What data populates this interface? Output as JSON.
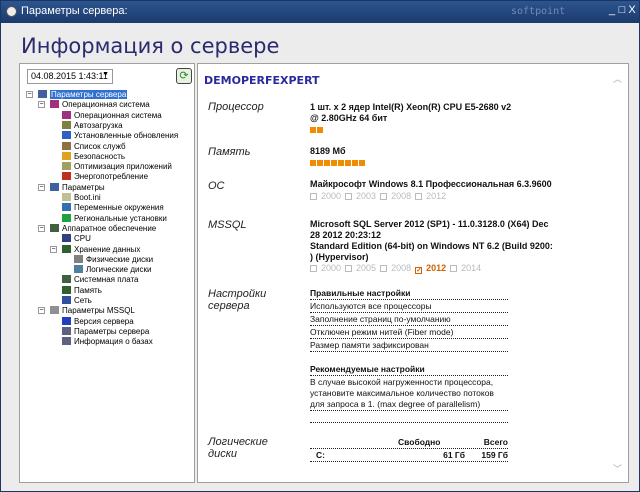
{
  "window": {
    "title": "Параметры сервера:",
    "brand": "softpoint",
    "minimize": "_",
    "maximize": "□",
    "close": "X"
  },
  "heading": "Информация о сервере",
  "date_combo": "04.08.2015 1:43:11",
  "tree": [
    {
      "label": "Параметры сервера",
      "level": 0,
      "color": "#4060a0",
      "expander": "−",
      "selected": true
    },
    {
      "label": "Операционная система",
      "level": 1,
      "color": "#a03080",
      "expander": "−"
    },
    {
      "label": "Операционная система",
      "level": 2,
      "color": "#a03080"
    },
    {
      "label": "Автозагрузка",
      "level": 2,
      "color": "#808040"
    },
    {
      "label": "Установленные обновления",
      "level": 2,
      "color": "#3060c0"
    },
    {
      "label": "Список служб",
      "level": 2,
      "color": "#907040"
    },
    {
      "label": "Безопасность",
      "level": 2,
      "color": "#e0a020"
    },
    {
      "label": "Оптимизация приложений",
      "level": 2,
      "color": "#a0a060"
    },
    {
      "label": "Энергопотребление",
      "level": 2,
      "color": "#c03020"
    },
    {
      "label": "Параметры",
      "level": 1,
      "color": "#4060a0",
      "expander": "−"
    },
    {
      "label": "Boot.ini",
      "level": 2,
      "color": "#c0c090"
    },
    {
      "label": "Переменные окружения",
      "level": 2,
      "color": "#3070b0"
    },
    {
      "label": "Региональные установки",
      "level": 2,
      "color": "#20a040"
    },
    {
      "label": "Аппаратное обеспечение",
      "level": 1,
      "color": "#406040",
      "expander": "−"
    },
    {
      "label": "CPU",
      "level": 2,
      "color": "#304080"
    },
    {
      "label": "Хранение данных",
      "level": 2,
      "color": "#306030",
      "expander": "−"
    },
    {
      "label": "Физические диски",
      "level": 3,
      "color": "#808080"
    },
    {
      "label": "Логические диски",
      "level": 3,
      "color": "#5080a0"
    },
    {
      "label": "Системная плата",
      "level": 2,
      "color": "#406040"
    },
    {
      "label": "Память",
      "level": 2,
      "color": "#306030"
    },
    {
      "label": "Сеть",
      "level": 2,
      "color": "#3050a0"
    },
    {
      "label": "Параметры MSSQL",
      "level": 1,
      "color": "#909090",
      "expander": "−"
    },
    {
      "label": "Версия сервера",
      "level": 2,
      "color": "#2040c0"
    },
    {
      "label": "Параметры сервера",
      "level": 2,
      "color": "#606080"
    },
    {
      "label": "Информация о базах",
      "level": 2,
      "color": "#606080"
    }
  ],
  "info": {
    "host": "DEMOPERFEXPERT",
    "cpu": {
      "label": "Процессор",
      "value": "1 шт. x 2 ядер Intel(R) Xeon(R) CPU E5-2680 v2 @ 2.80GHz 64 бит",
      "cores": 2
    },
    "memory": {
      "label": "Память",
      "value": "8189 Мб",
      "blocks": 8
    },
    "os": {
      "label": "ОС",
      "value": "Майкрософт Windows 8.1 Профессиональная 6.3.9600",
      "versions": [
        {
          "v": "2000",
          "checked": false
        },
        {
          "v": "2003",
          "checked": false
        },
        {
          "v": "2008",
          "checked": false
        },
        {
          "v": "2012",
          "checked": false
        }
      ]
    },
    "mssql": {
      "label": "MSSQL",
      "line1": "Microsoft SQL Server 2012 (SP1) - 11.0.3128.0 (X64) Dec 28 2012 20:23:12",
      "line2": "Standard Edition (64-bit) on Windows NT 6.2 (Build 9200: ) (Hypervisor)",
      "versions": [
        {
          "v": "2000",
          "checked": false
        },
        {
          "v": "2005",
          "checked": false
        },
        {
          "v": "2008",
          "checked": false
        },
        {
          "v": "2012",
          "checked": true
        },
        {
          "v": "2014",
          "checked": false
        }
      ]
    },
    "settings": {
      "label1": "Настройки",
      "label2": "сервера",
      "correct_title": "Правильные настройки",
      "correct": [
        "Используются все процессоры",
        "Заполнение страниц по-умолчанию",
        "Отключен режим нитей (Fiber mode)",
        "Размер памяти зафиксирован"
      ],
      "recommended_title": "Рекомендуемые настройки",
      "recommended": "В случае высокой нагруженности процессора, установите максимальное количество потоков для запроса в 1. (max degree of parallelism)"
    },
    "disks": {
      "label1": "Логические",
      "label2": "диски",
      "col_free": "Свободно",
      "col_total": "Всего",
      "rows": [
        {
          "name": "C:",
          "free": "61 Гб",
          "total": "159 Гб"
        }
      ]
    }
  }
}
